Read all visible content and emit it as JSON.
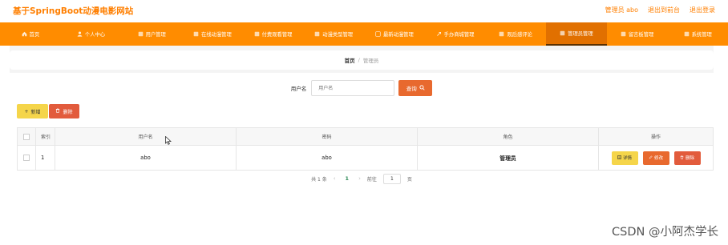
{
  "header": {
    "title": "基于SpringBoot动漫电影网站",
    "links": [
      "管理员 abo",
      "退出到前台",
      "退出登录"
    ]
  },
  "nav": {
    "items": [
      {
        "label": "首页",
        "icon": "home-icon"
      },
      {
        "label": "个人中心",
        "icon": "user-icon"
      },
      {
        "label": "用户管理",
        "icon": "users-icon"
      },
      {
        "label": "在线动漫管理",
        "icon": "film-icon"
      },
      {
        "label": "付费观看管理",
        "icon": "pay-icon"
      },
      {
        "label": "动漫类型管理",
        "icon": "tag-icon"
      },
      {
        "label": "最新动漫管理",
        "icon": "new-icon"
      },
      {
        "label": "手办商城管理",
        "icon": "shop-icon"
      },
      {
        "label": "观后感评论",
        "icon": "comment-icon"
      },
      {
        "label": "管理员管理",
        "icon": "admin-icon",
        "active": true
      },
      {
        "label": "留言板管理",
        "icon": "message-icon"
      },
      {
        "label": "系统管理",
        "icon": "settings-icon"
      }
    ]
  },
  "breadcrumb": {
    "home": "首页",
    "separator": "/",
    "current": "管理员"
  },
  "search": {
    "label": "用户名",
    "placeholder": "用户名",
    "button_label": "查询"
  },
  "actions": {
    "add_label": "新增",
    "delete_label": "删除"
  },
  "table": {
    "headers": [
      "索引",
      "用户名",
      "密码",
      "角色",
      "操作"
    ],
    "rows": [
      {
        "index": "1",
        "username": "abo",
        "password": "abo",
        "role": "管理员"
      }
    ],
    "row_actions": {
      "detail": "详情",
      "edit": "修改",
      "delete": "删除"
    }
  },
  "pagination": {
    "total_text": "共 1 条",
    "prev": "‹",
    "current_page": "1",
    "next": "›",
    "goto_label": "前往",
    "goto_value": "1",
    "page_suffix": "页"
  },
  "watermark": "CSDN @小阿杰学长",
  "colors": {
    "brand_orange": "#ff8c00",
    "title_orange": "#ff7f00",
    "button_yellow": "#f5d54a",
    "button_orange": "#e8692e",
    "button_red": "#e25b3c"
  }
}
